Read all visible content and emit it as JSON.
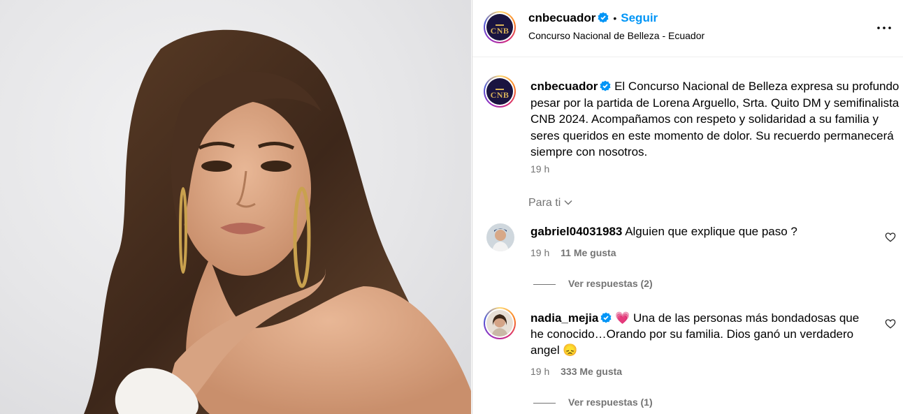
{
  "post": {
    "username": "cnbecuador",
    "follow_label": "Seguir",
    "location": "Concurso Nacional de Belleza - Ecuador",
    "logo_text": "CNB",
    "caption": "El Concurso Nacional de Belleza expresa su profundo pesar por la partida de Lorena Arguello, Srta. Quito DM y semifinalista CNB 2024. Acompañamos con respeto y solidaridad a su familia y seres queridos en este momento de dolor. Su recuerdo permanecerá siempre con nosotros.",
    "time": "19 h"
  },
  "filter_label": "Para ti",
  "comments": [
    {
      "username": "gabriel04031983",
      "text": "Alguien que explique que paso ?",
      "time": "19 h",
      "likes": "11 Me gusta",
      "replies": "Ver respuestas (2)"
    },
    {
      "username": "nadia_mejia",
      "text_line1": "Una de las personas más bondadosas que",
      "text_line2": "he conocido…Orando por su familia. Dios ganó un verdadero",
      "text_line3": "angel",
      "emoji_lead": "💗",
      "emoji_tail": "😞",
      "time": "19 h",
      "likes": "333 Me gusta",
      "replies": "Ver respuestas (1)"
    }
  ],
  "colors": {
    "accent": "#0095f6",
    "muted": "#737373",
    "logo_bg": "#1a1440",
    "logo_gold": "#d7b25a"
  }
}
